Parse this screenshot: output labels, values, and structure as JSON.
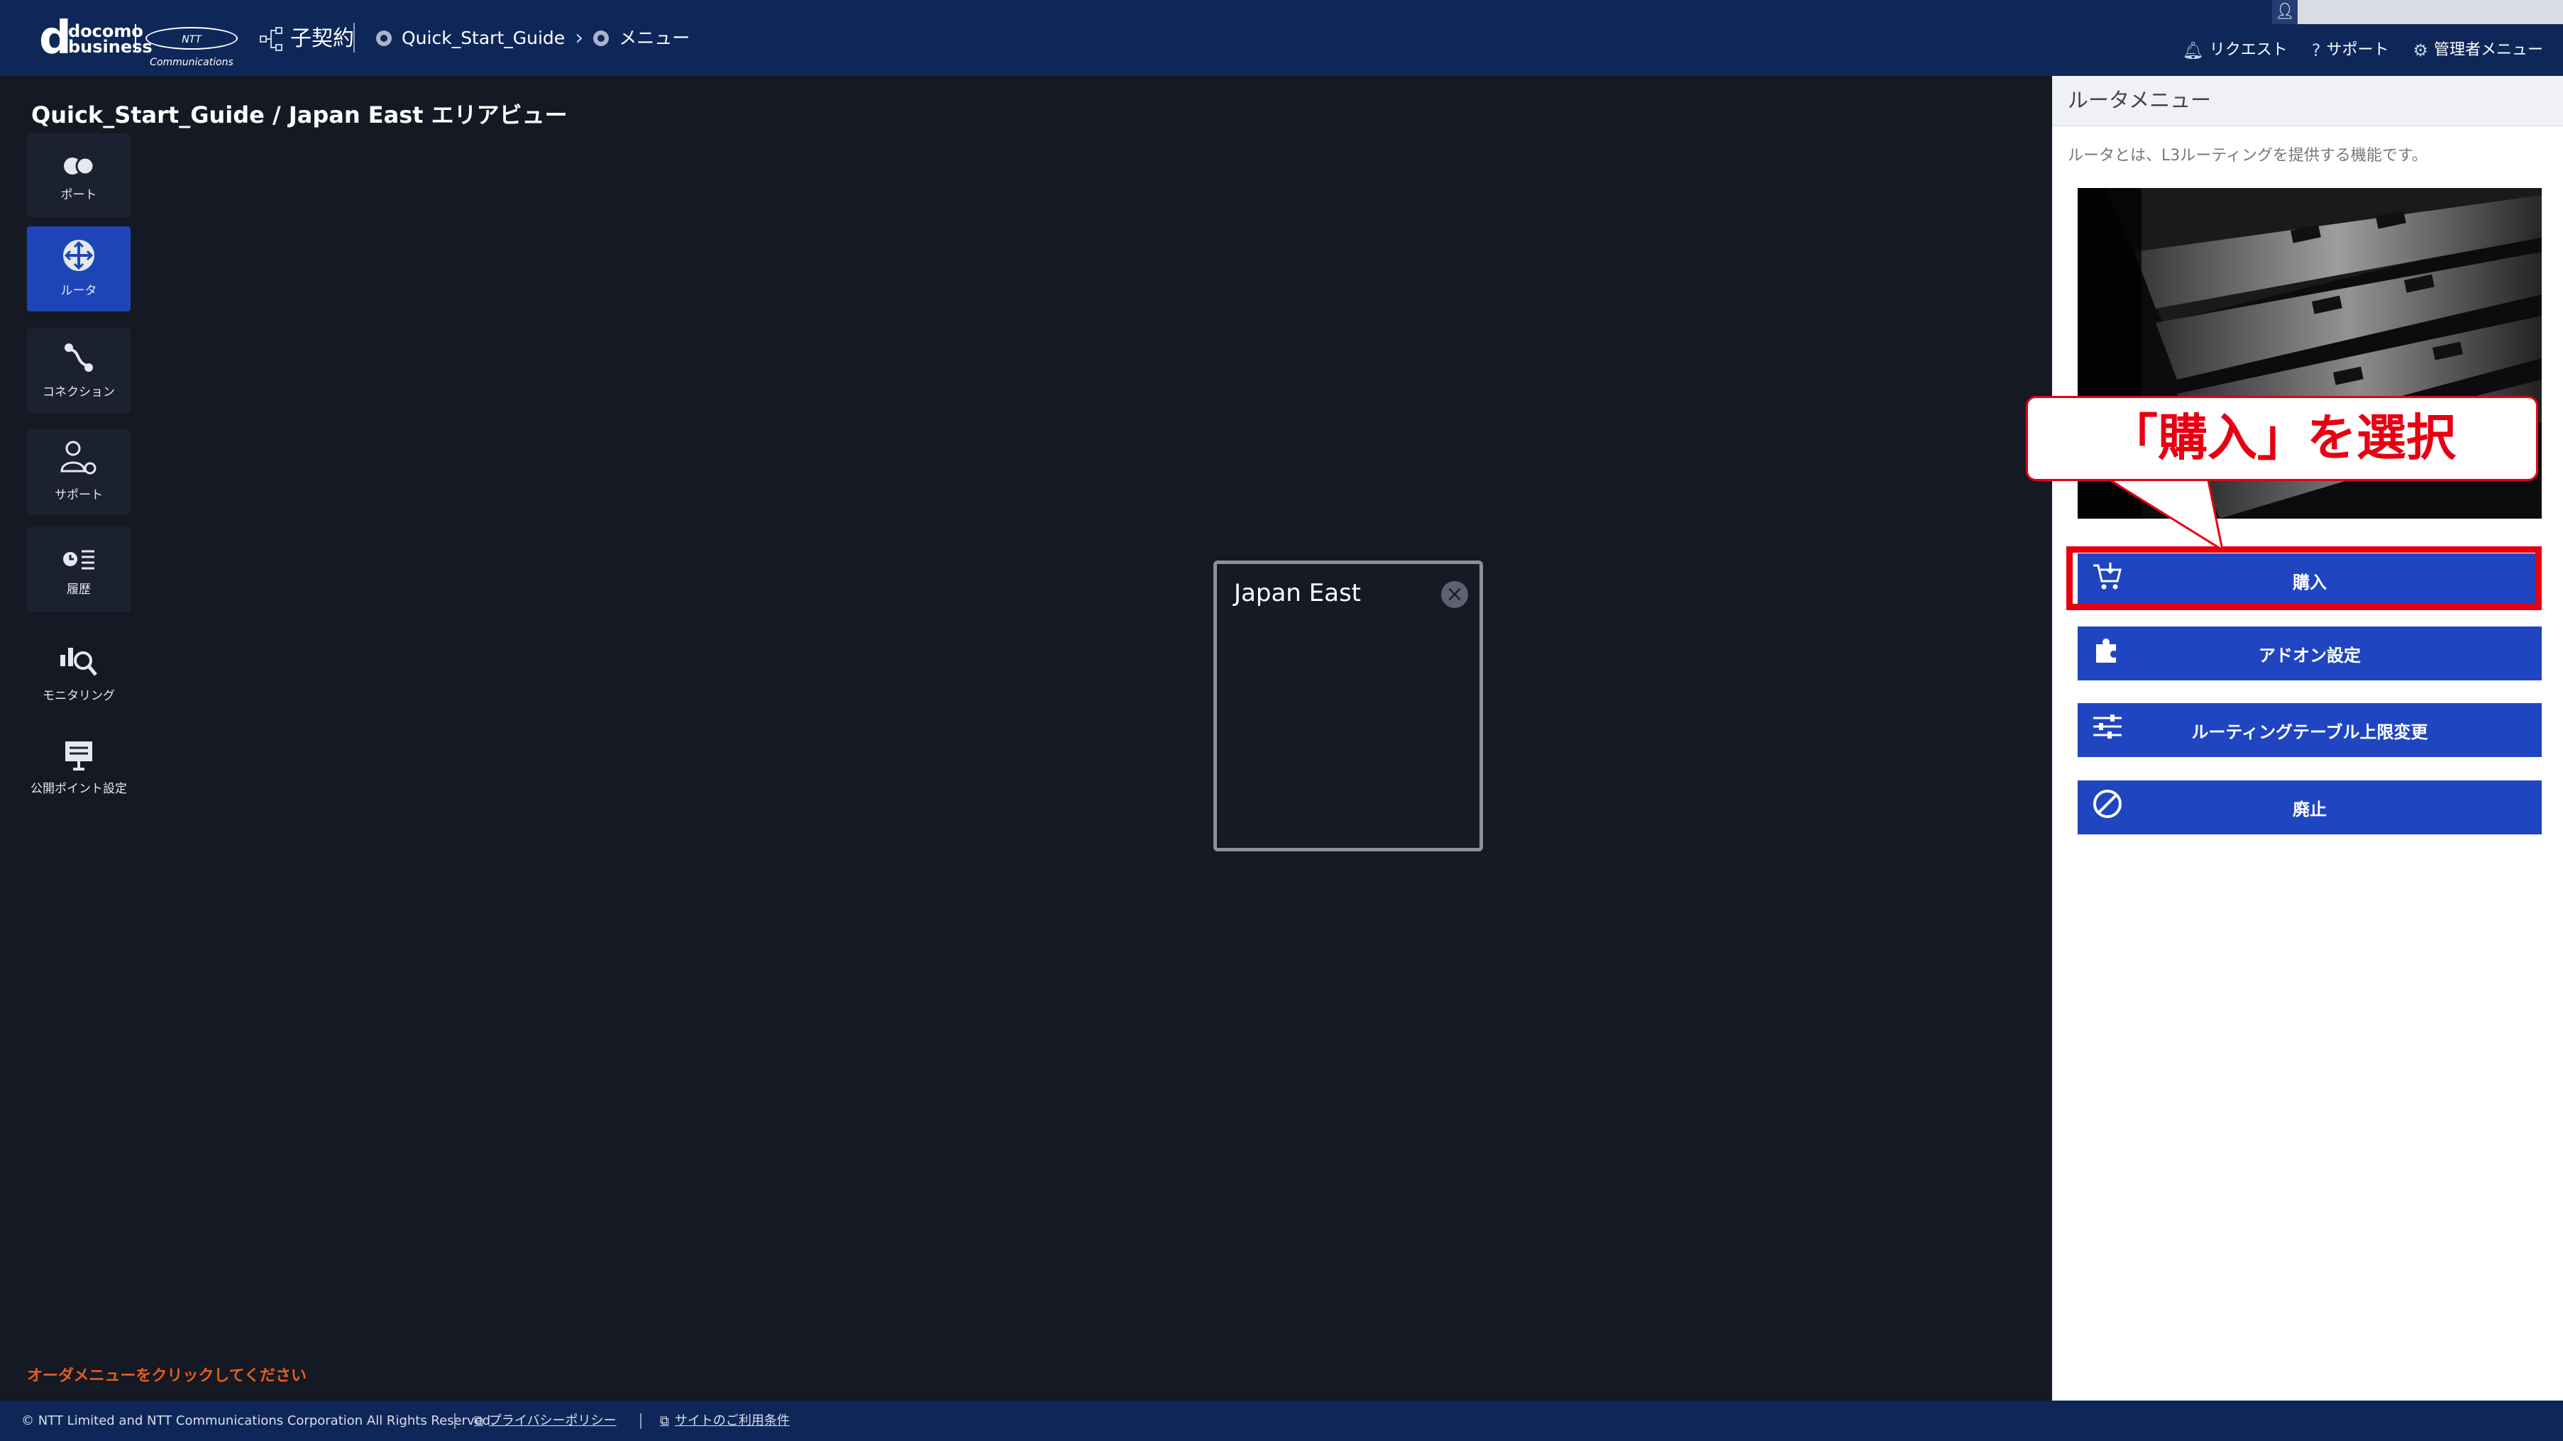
{
  "header": {
    "logo_d": "d",
    "logo_docomo": "docomo",
    "logo_business": "business",
    "logo_ntt": "NTT Communications",
    "contract_label": "子契約",
    "breadcrumb": [
      "Quick_Start_Guide",
      "メニュー"
    ],
    "util_links": [
      {
        "label": "リクエスト",
        "icon": "bell-icon"
      },
      {
        "label": "サポート",
        "icon": "help-icon"
      },
      {
        "label": "管理者メニュー",
        "icon": "gear-icon"
      }
    ]
  },
  "page": {
    "title": "Quick_Start_Guide / Japan East エリアビュー",
    "bottom_hint": "オーダメニューをクリックしてください"
  },
  "sidenav": [
    {
      "label": "ポート",
      "icon": "port-icon",
      "active": false
    },
    {
      "label": "ルータ",
      "icon": "router-icon",
      "active": true
    },
    {
      "label": "コネクション",
      "icon": "connection-icon",
      "active": false
    },
    {
      "label": "サポート",
      "icon": "support-icon",
      "active": false
    },
    {
      "label": "履歴",
      "icon": "history-icon",
      "active": false
    },
    {
      "label": "モニタリング",
      "icon": "monitoring-icon",
      "active": false
    },
    {
      "label": "公開ポイント設定",
      "icon": "public-point-icon",
      "active": false
    }
  ],
  "region_card": {
    "title": "Japan East"
  },
  "router_panel": {
    "title": "ルータメニュー",
    "description": "ルータとは、L3ルーティングを提供する機能です。",
    "buttons": [
      {
        "label": "購入",
        "icon": "cart-icon"
      },
      {
        "label": "アドオン設定",
        "icon": "puzzle-icon"
      },
      {
        "label": "ルーティングテーブル上限変更",
        "icon": "sliders-icon"
      },
      {
        "label": "廃止",
        "icon": "prohibit-icon"
      }
    ]
  },
  "annotation": {
    "callout_text": "「購入」を選択",
    "color": "#e60012"
  },
  "footer": {
    "copyright": "© NTT Limited and NTT Communications Corporation All Rights Reserved.",
    "links": [
      "プライバシーポリシー",
      "サイトのご利用条件"
    ]
  },
  "colors": {
    "header_bg": "#0f2758",
    "accent_blue": "#1f45c0",
    "hint_orange": "#e65d1e"
  }
}
